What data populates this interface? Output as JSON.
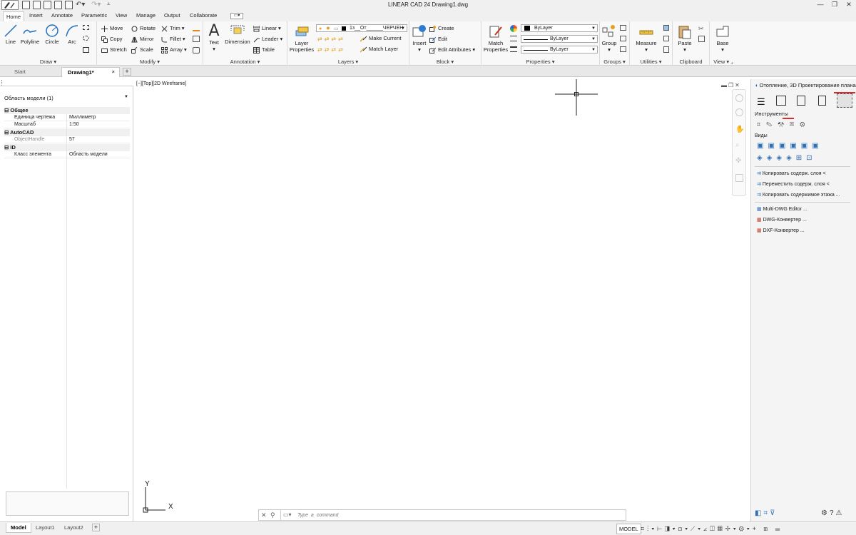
{
  "app": {
    "title": "LINEAR CAD 24    Drawing1.dwg",
    "window_controls": [
      "minimize",
      "maximize",
      "close"
    ]
  },
  "ribbon_tabs": [
    "Home",
    "Insert",
    "Annotate",
    "Parametric",
    "View",
    "Manage",
    "Output",
    "Collaborate"
  ],
  "ribbon": {
    "draw": {
      "title": "Draw",
      "line": "Line",
      "polyline": "Polyline",
      "circle": "Circle",
      "arc": "Arc"
    },
    "modify": {
      "title": "Modify",
      "move": "Move",
      "rotate": "Rotate",
      "trim": "Trim",
      "copy": "Copy",
      "mirror": "Mirror",
      "fillet": "Fillet",
      "stretch": "Stretch",
      "scale": "Scale",
      "array": "Array"
    },
    "annotation": {
      "title": "Annotation",
      "text": "Text",
      "dimension": "Dimension",
      "linear": "Linear",
      "leader": "Leader",
      "table": "Table"
    },
    "layers": {
      "title": "Layers",
      "layer_properties_1": "Layer",
      "layer_properties_2": "Properties",
      "layer_combo": "1з__От______ЧЕРЧЕН",
      "make_current": "Make Current",
      "match_layer": "Match Layer"
    },
    "block": {
      "title": "Block",
      "insert": "Insert",
      "create": "Create",
      "edit": "Edit",
      "edit_attributes": "Edit Attributes"
    },
    "properties": {
      "title": "Properties",
      "match_1": "Match",
      "match_2": "Properties",
      "color": "ByLayer",
      "linetype": "ByLayer",
      "lineweight": "ByLayer"
    },
    "groups": {
      "title": "Groups",
      "group": "Group"
    },
    "utilities": {
      "title": "Utilities",
      "measure": "Measure"
    },
    "clipboard": {
      "title": "Clipboard",
      "paste": "Paste"
    },
    "view": {
      "title": "View",
      "base": "Base"
    }
  },
  "doc_tabs": {
    "start": "Start",
    "drawing": "Drawing1*",
    "close": "×",
    "add": "+"
  },
  "properties_panel": {
    "selector": "Область модели (1)",
    "categories": [
      {
        "name": "Общее",
        "rows": [
          {
            "key": "Единица чертежа",
            "value": "Миллиметр"
          },
          {
            "key": "Масштаб",
            "value": "1:50"
          }
        ]
      },
      {
        "name": "AutoCAD",
        "rows": [
          {
            "key": "ObjectHandle",
            "value": "57"
          }
        ]
      },
      {
        "name": "ID",
        "rows": [
          {
            "key": "Класс элемента",
            "value": "Область модели"
          }
        ]
      }
    ]
  },
  "viewport": {
    "label": "[−][Top][2D Wireframe]",
    "ucs_y": "Y",
    "ucs_x": "X"
  },
  "command": {
    "placeholder": "Type  a  command"
  },
  "right_panel": {
    "title": "Отопление, 3D Проектирование плана",
    "section_tools": "Инструменты",
    "section_views": "Виды",
    "items": [
      "Копировать содерж. слоя <",
      "Переместить содерж. слоя <",
      "Копировать содержимое этажа ...",
      "Multi-DWG Editor ...",
      "DWG-Конвертер ...",
      "DXF-Конвертер ..."
    ]
  },
  "status": {
    "layouts": [
      "Model",
      "Layout1",
      "Layout2"
    ],
    "add": "+",
    "mode": "MODEL"
  }
}
